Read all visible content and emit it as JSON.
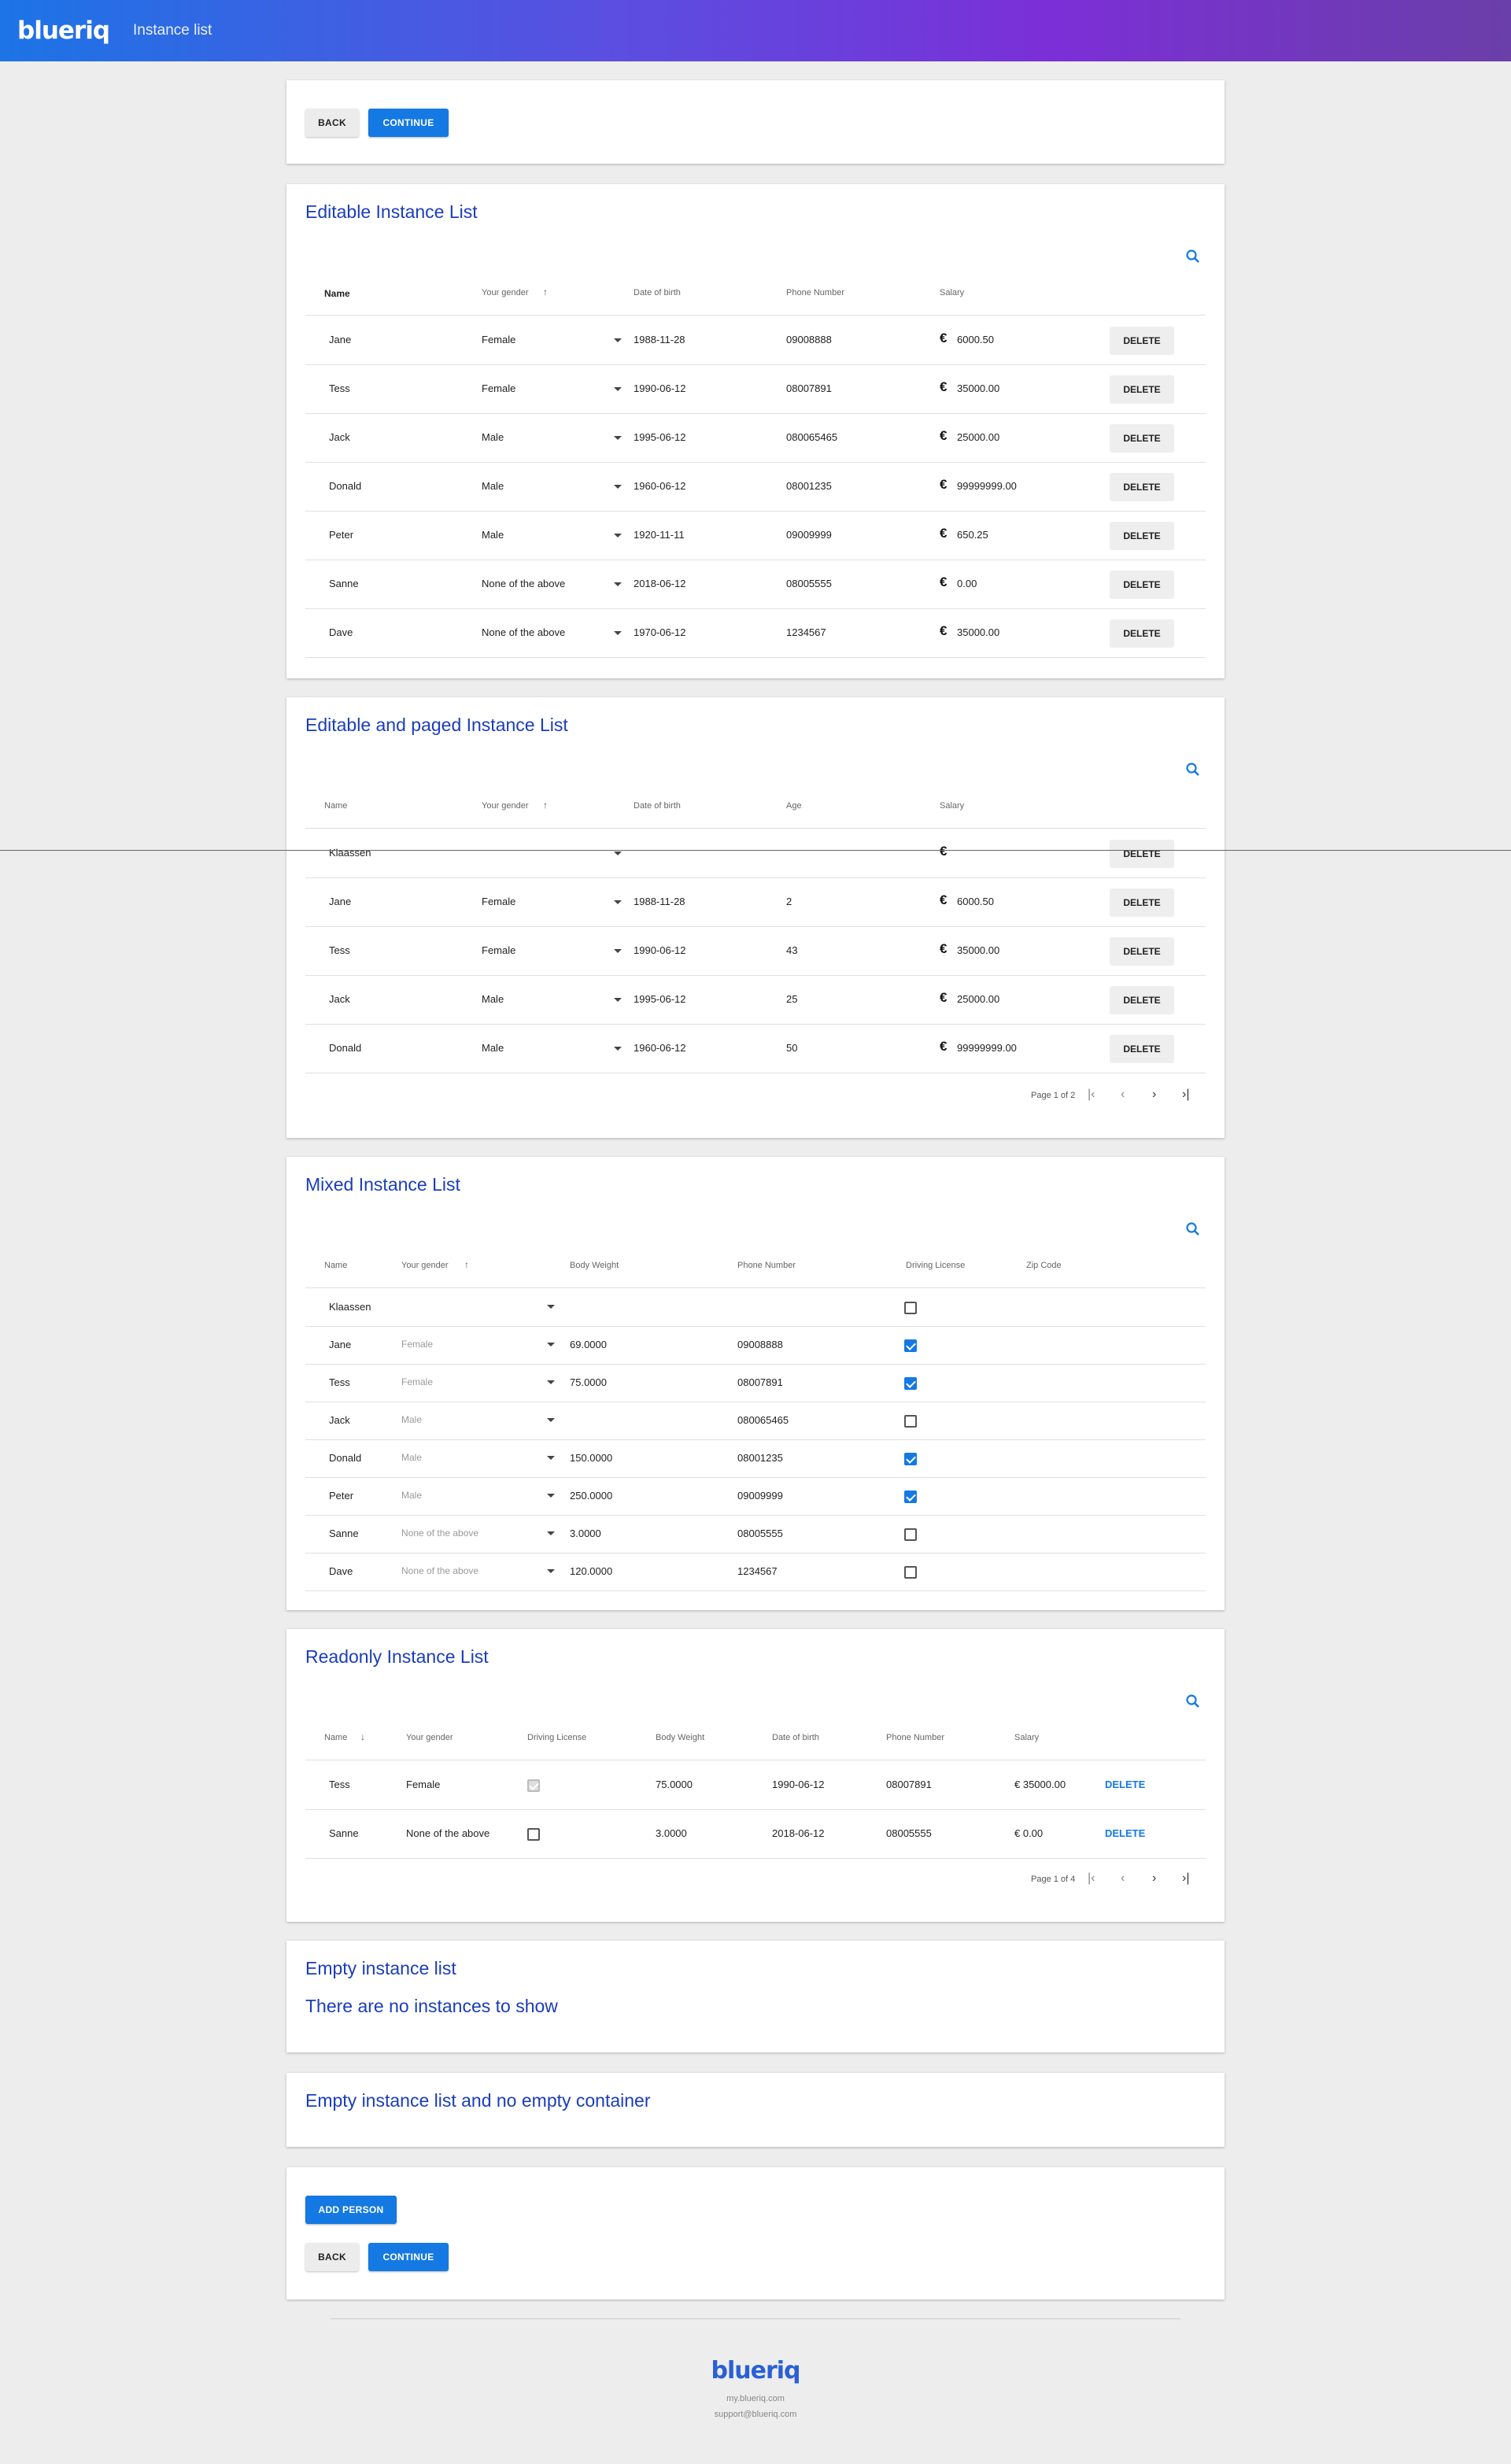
{
  "header": {
    "logo": "blueriq",
    "title": "Instance list"
  },
  "top_actions": {
    "back": "BACK",
    "continue": "CONTINUE"
  },
  "editable": {
    "title": "Editable Instance List",
    "columns": [
      "Name",
      "Your gender",
      "Date of birth",
      "Phone Number",
      "Salary"
    ],
    "delete_label": "DELETE",
    "currency": "€",
    "rows": [
      {
        "name": "Jane",
        "gender": "Female",
        "dob": "1988-11-28",
        "phone": "09008888",
        "salary": "6000.50"
      },
      {
        "name": "Tess",
        "gender": "Female",
        "dob": "1990-06-12",
        "phone": "08007891",
        "salary": "35000.00"
      },
      {
        "name": "Jack",
        "gender": "Male",
        "dob": "1995-06-12",
        "phone": "080065465",
        "salary": "25000.00"
      },
      {
        "name": "Donald",
        "gender": "Male",
        "dob": "1960-06-12",
        "phone": "08001235",
        "salary": "99999999.00"
      },
      {
        "name": "Peter",
        "gender": "Male",
        "dob": "1920-11-11",
        "phone": "09009999",
        "salary": "650.25"
      },
      {
        "name": "Sanne",
        "gender": "None of the above",
        "dob": "2018-06-12",
        "phone": "08005555",
        "salary": "0.00"
      },
      {
        "name": "Dave",
        "gender": "None of the above",
        "dob": "1970-06-12",
        "phone": "1234567",
        "salary": "35000.00"
      }
    ]
  },
  "paged": {
    "title": "Editable and paged Instance List",
    "columns": [
      "Name",
      "Your gender",
      "Date of birth",
      "Age",
      "Salary"
    ],
    "delete_label": "DELETE",
    "currency": "€",
    "rows": [
      {
        "name": "Klaassen",
        "gender": "",
        "dob": "",
        "age": "",
        "salary": ""
      },
      {
        "name": "Jane",
        "gender": "Female",
        "dob": "1988-11-28",
        "age": "2",
        "salary": "6000.50"
      },
      {
        "name": "Tess",
        "gender": "Female",
        "dob": "1990-06-12",
        "age": "43",
        "salary": "35000.00"
      },
      {
        "name": "Jack",
        "gender": "Male",
        "dob": "1995-06-12",
        "age": "25",
        "salary": "25000.00"
      },
      {
        "name": "Donald",
        "gender": "Male",
        "dob": "1960-06-12",
        "age": "50",
        "salary": "99999999.00"
      }
    ],
    "pager": "Page 1 of 2"
  },
  "mixed": {
    "title": "Mixed Instance List",
    "columns": [
      "Name",
      "Your gender",
      "Body Weight",
      "Phone Number",
      "Driving License",
      "Zip Code"
    ],
    "rows": [
      {
        "name": "Klaassen",
        "gender": "",
        "weight": "",
        "phone": "",
        "license": false
      },
      {
        "name": "Jane",
        "gender": "Female",
        "weight": "69.0000",
        "phone": "09008888",
        "license": true
      },
      {
        "name": "Tess",
        "gender": "Female",
        "weight": "75.0000",
        "phone": "08007891",
        "license": true
      },
      {
        "name": "Jack",
        "gender": "Male",
        "weight": "",
        "phone": "080065465",
        "license": false
      },
      {
        "name": "Donald",
        "gender": "Male",
        "weight": "150.0000",
        "phone": "08001235",
        "license": true
      },
      {
        "name": "Peter",
        "gender": "Male",
        "weight": "250.0000",
        "phone": "09009999",
        "license": true
      },
      {
        "name": "Sanne",
        "gender": "None of the above",
        "weight": "3.0000",
        "phone": "08005555",
        "license": false
      },
      {
        "name": "Dave",
        "gender": "None of the above",
        "weight": "120.0000",
        "phone": "1234567",
        "license": false
      }
    ]
  },
  "readonly": {
    "title": "Readonly Instance List",
    "columns": [
      "Name",
      "Your gender",
      "Driving License",
      "Body Weight",
      "Date of birth",
      "Phone Number",
      "Salary"
    ],
    "delete_label": "DELETE",
    "rows": [
      {
        "name": "Tess",
        "gender": "Female",
        "license": true,
        "weight": "75.0000",
        "dob": "1990-06-12",
        "phone": "08007891",
        "salary": "€ 35000.00"
      },
      {
        "name": "Sanne",
        "gender": "None of the above",
        "license": false,
        "weight": "3.0000",
        "dob": "2018-06-12",
        "phone": "08005555",
        "salary": "€ 0.00"
      }
    ],
    "pager": "Page 1 of 4"
  },
  "empty": {
    "title": "Empty instance list",
    "message": "There are no instances to show"
  },
  "empty_nocontainer": {
    "title": "Empty instance list and no empty container"
  },
  "bottom_actions": {
    "add_person": "ADD PERSON",
    "back": "BACK",
    "continue": "CONTINUE"
  },
  "footer": {
    "logo": "blueriq",
    "link1": "my.blueriq.com",
    "link2": "support@blueriq.com"
  },
  "colors": {
    "accent": "#1479e2",
    "title": "#1b3dbb"
  }
}
